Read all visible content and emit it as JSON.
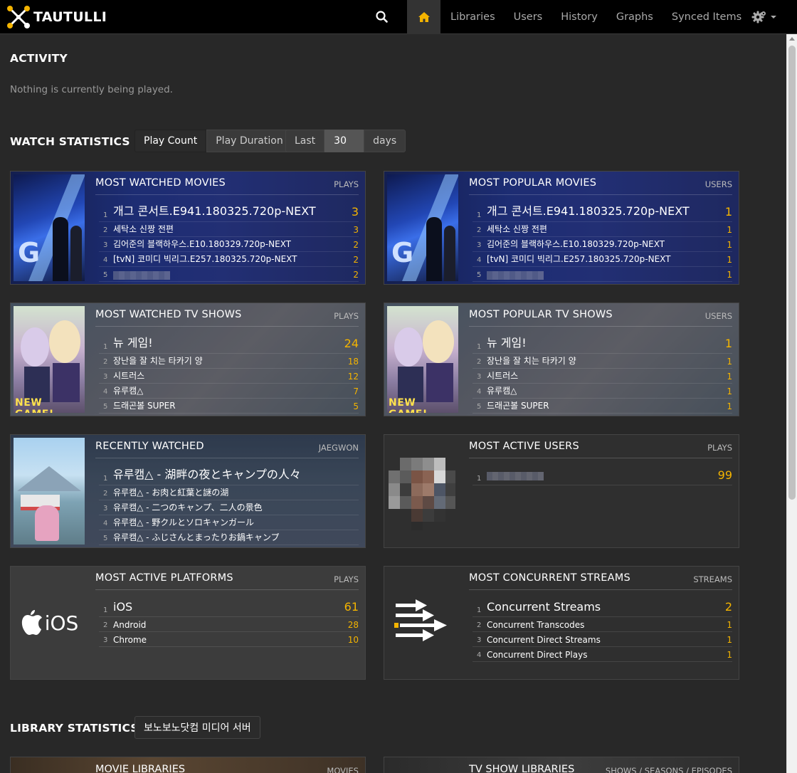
{
  "brand": {
    "name": "TAUTULLI"
  },
  "nav": {
    "search_icon": "search-icon",
    "home_icon": "home-icon",
    "links": [
      "Libraries",
      "Users",
      "History",
      "Graphs",
      "Synced Items"
    ],
    "settings_icon": "gear-icon"
  },
  "activity": {
    "title": "ACTIVITY",
    "message": "Nothing is currently being played."
  },
  "watch_stats": {
    "title": "WATCH STATISTICS",
    "play_count_label": "Play Count",
    "play_duration_label": "Play Duration",
    "last_label": "Last",
    "days_value": "30",
    "days_label": "days"
  },
  "cards": {
    "most_watched_movies": {
      "title": "MOST WATCHED MOVIES",
      "unit": "PLAYS",
      "rows": [
        {
          "rank": "1",
          "title": "개그 콘서트.E941.180325.720p-NEXT",
          "count": "3"
        },
        {
          "rank": "2",
          "title": "세탁소 신짱 전편",
          "count": "3"
        },
        {
          "rank": "3",
          "title": "김어준의 블랙하우스.E10.180329.720p-NEXT",
          "count": "2"
        },
        {
          "rank": "4",
          "title": "[tvN] 코미디 빅리그.E257.180325.720p-NEXT",
          "count": "2"
        },
        {
          "rank": "5",
          "title": "",
          "count": "2"
        }
      ]
    },
    "most_popular_movies": {
      "title": "MOST POPULAR MOVIES",
      "unit": "USERS",
      "rows": [
        {
          "rank": "1",
          "title": "개그 콘서트.E941.180325.720p-NEXT",
          "count": "1"
        },
        {
          "rank": "2",
          "title": "세탁소 신짱 전편",
          "count": "1"
        },
        {
          "rank": "3",
          "title": "김어준의 블랙하우스.E10.180329.720p-NEXT",
          "count": "1"
        },
        {
          "rank": "4",
          "title": "[tvN] 코미디 빅리그.E257.180325.720p-NEXT",
          "count": "1"
        },
        {
          "rank": "5",
          "title": "",
          "count": "1"
        }
      ]
    },
    "most_watched_tv": {
      "title": "MOST WATCHED TV SHOWS",
      "unit": "PLAYS",
      "rows": [
        {
          "rank": "1",
          "title": "뉴 게임!",
          "count": "24"
        },
        {
          "rank": "2",
          "title": "장난을 잘 치는 타카기 양",
          "count": "18"
        },
        {
          "rank": "3",
          "title": "시트러스",
          "count": "12"
        },
        {
          "rank": "4",
          "title": "유루캠△",
          "count": "7"
        },
        {
          "rank": "5",
          "title": "드래곤볼 SUPER",
          "count": "5"
        }
      ]
    },
    "most_popular_tv": {
      "title": "MOST POPULAR TV SHOWS",
      "unit": "USERS",
      "rows": [
        {
          "rank": "1",
          "title": "뉴 게임!",
          "count": "1"
        },
        {
          "rank": "2",
          "title": "장난을 잘 치는 타카기 양",
          "count": "1"
        },
        {
          "rank": "3",
          "title": "시트러스",
          "count": "1"
        },
        {
          "rank": "4",
          "title": "유루캠△",
          "count": "1"
        },
        {
          "rank": "5",
          "title": "드래곤볼 SUPER",
          "count": "1"
        }
      ]
    },
    "recently_watched": {
      "title": "RECENTLY WATCHED",
      "unit": "JAEGWON",
      "rows": [
        {
          "rank": "1",
          "title": "유루캠△ - 湖畔の夜とキャンプの人々"
        },
        {
          "rank": "2",
          "title": "유루캠△ - お肉と紅葉と謎の湖"
        },
        {
          "rank": "3",
          "title": "유루캠△ - 二つのキャンプ、二人の景色"
        },
        {
          "rank": "4",
          "title": "유루캠△ - 野クルとソロキャンガール"
        },
        {
          "rank": "5",
          "title": "유루캠△ - ふじさんとまったりお鍋キャンプ"
        }
      ]
    },
    "most_active_users": {
      "title": "MOST ACTIVE USERS",
      "unit": "PLAYS",
      "rows": [
        {
          "rank": "1",
          "title": "",
          "count": "99"
        }
      ]
    },
    "most_active_platforms": {
      "title": "MOST ACTIVE PLATFORMS",
      "unit": "PLAYS",
      "logo_text": "iOS",
      "rows": [
        {
          "rank": "1",
          "title": "iOS",
          "count": "61"
        },
        {
          "rank": "2",
          "title": "Android",
          "count": "28"
        },
        {
          "rank": "3",
          "title": "Chrome",
          "count": "10"
        }
      ]
    },
    "most_concurrent_streams": {
      "title": "MOST CONCURRENT STREAMS",
      "unit": "STREAMS",
      "rows": [
        {
          "rank": "1",
          "title": "Concurrent Streams",
          "count": "2"
        },
        {
          "rank": "2",
          "title": "Concurrent Transcodes",
          "count": "1"
        },
        {
          "rank": "3",
          "title": "Concurrent Direct Streams",
          "count": "1"
        },
        {
          "rank": "4",
          "title": "Concurrent Direct Plays",
          "count": "1"
        }
      ]
    }
  },
  "library_stats": {
    "title": "LIBRARY STATISTICS",
    "server_label": "보노보노닷컴 미디어 서버",
    "movie_libraries": {
      "title": "MOVIE LIBRARIES",
      "unit": "MOVIES"
    },
    "tv_libraries": {
      "title": "TV SHOW LIBRARIES",
      "unit": "SHOWS / SEASONS / EPISODES"
    }
  },
  "colors": {
    "accent": "#f4b400",
    "background": "#282828",
    "navbar": "#000000"
  }
}
